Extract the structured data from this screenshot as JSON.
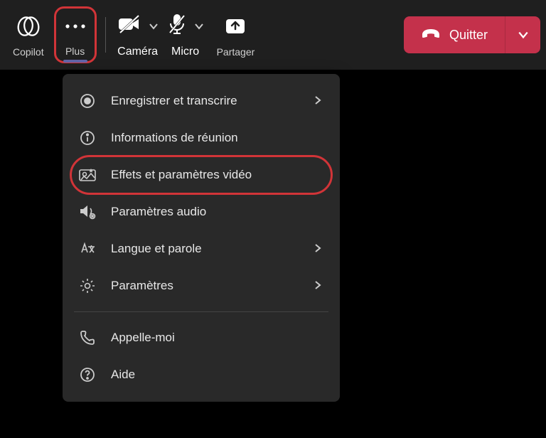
{
  "toolbar": {
    "copilot": "Copilot",
    "plus": "Plus",
    "camera": "Caméra",
    "micro": "Micro",
    "share": "Partager",
    "quit": "Quitter"
  },
  "menu": {
    "record": "Enregistrer et transcrire",
    "meeting_info": "Informations de réunion",
    "video_effects": "Effets et paramètres vidéo",
    "audio_settings": "Paramètres audio",
    "language": "Langue et parole",
    "settings": "Paramètres",
    "call_me": "Appelle-moi",
    "help": "Aide"
  }
}
